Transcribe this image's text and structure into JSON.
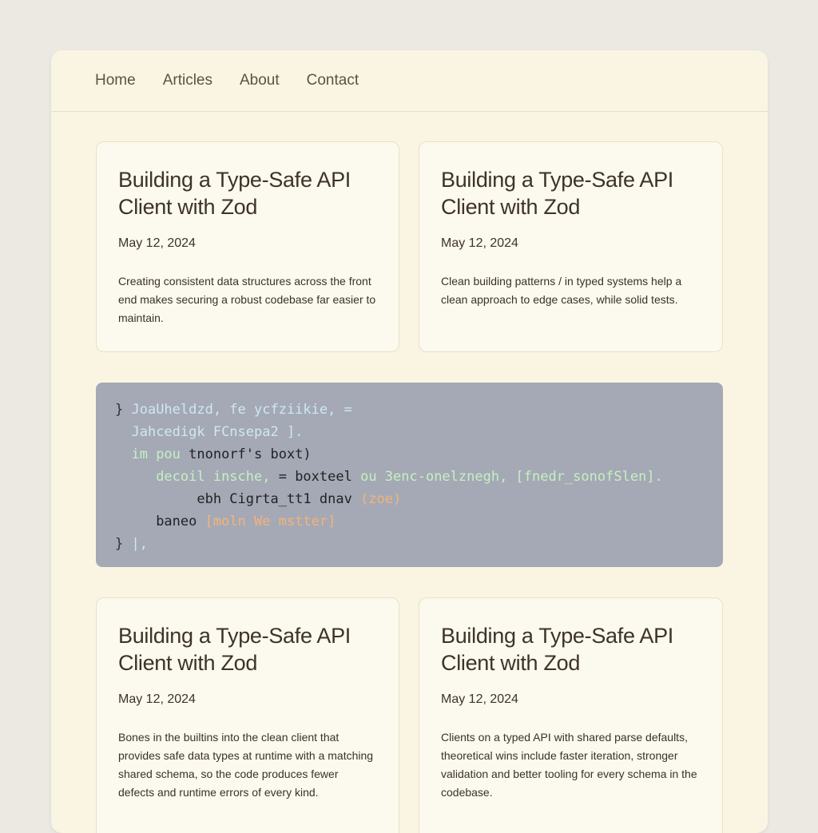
{
  "nav": {
    "items": [
      "Home",
      "Articles",
      "About",
      "Contact"
    ]
  },
  "cards": [
    {
      "title": "Building a Type-Safe API Client with Zod",
      "date": "May 12, 2024",
      "excerpt": "Creating consistent data structures across the front end makes securing a robust codebase far easier to maintain."
    },
    {
      "title": "Building a Type-Safe API Client with Zod",
      "date": "May 12, 2024",
      "excerpt": "Clean building patterns / in typed systems help a clean approach to edge cases, while solid tests."
    },
    {
      "title": "Building a Type-Safe API Client with Zod",
      "date": "May 12, 2024",
      "excerpt": "Bones in the builtins into the clean client that provides safe data types at runtime with a matching shared schema, so the code produces fewer defects and runtime errors of every kind."
    },
    {
      "title": "Building a Type-Safe API Client with Zod",
      "date": "May 12, 2024",
      "excerpt": "Clients on a typed API with shared parse defaults, theoretical wins include faster iteration, stronger validation and better tooling for every schema in the codebase."
    }
  ],
  "code": {
    "lines": [
      {
        "indent": "",
        "parts": [
          [
            "k",
            "} "
          ],
          [
            "b",
            "JoaUheldzd, fe ycfziikie, ="
          ]
        ]
      },
      {
        "indent": "  ",
        "parts": [
          [
            "b",
            "Jahcedigk FCnsepa2 ]."
          ]
        ]
      },
      {
        "indent": "  ",
        "parts": [
          [
            "g",
            "im pou "
          ],
          [
            "t",
            "tnonorf's boxt)"
          ]
        ]
      },
      {
        "indent": "     ",
        "parts": [
          [
            "g",
            "decoil insche, "
          ],
          [
            "t",
            "= boxteel "
          ],
          [
            "g",
            "ou 3enc-onelznegh, [fnedr_sonofSlen]."
          ]
        ]
      },
      {
        "indent": "          ",
        "parts": [
          [
            "t",
            "ebh Cigrta_tt1 dnav "
          ],
          [
            "o",
            "(zoe)"
          ]
        ]
      },
      {
        "indent": "     ",
        "parts": [
          [
            "t",
            "baneo "
          ],
          [
            "o",
            "[moln We mstter]"
          ]
        ]
      },
      {
        "indent": "",
        "parts": [
          [
            "k",
            "} "
          ],
          [
            "b",
            "|,"
          ]
        ]
      }
    ]
  }
}
